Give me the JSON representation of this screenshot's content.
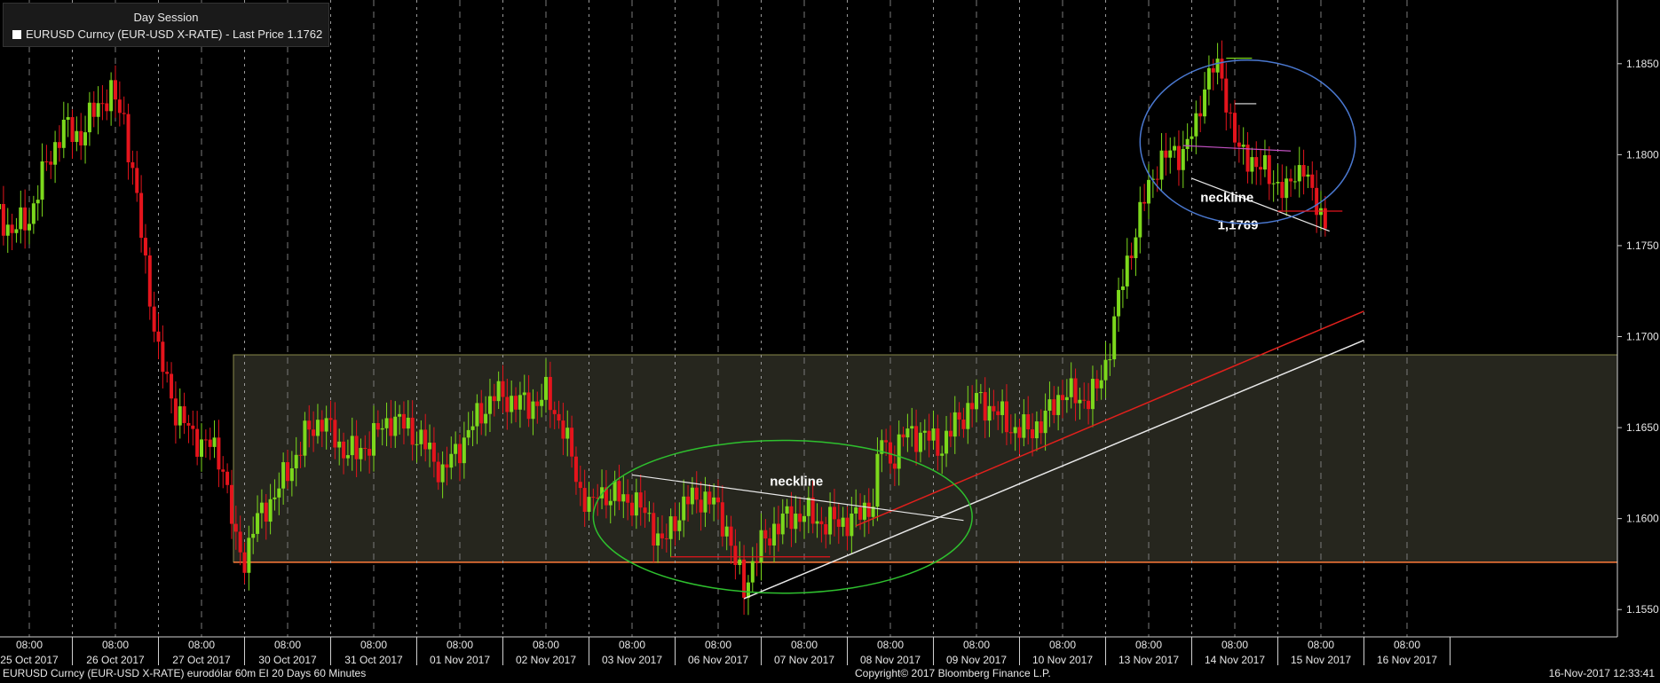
{
  "header": {
    "session": "Day Session",
    "series_label": "EURUSD Curncy (EUR-USD X-RATE) - Last Price 1.1762"
  },
  "footer": {
    "left": "EURUSD Curncy (EUR-USD X-RATE) eurodólar 60m EI 20 Days 60 Minutes",
    "center": "Copyright© 2017 Bloomberg Finance L.P.",
    "right": "16-Nov-2017 12:33:41"
  },
  "colors": {
    "up_candle": "#7cd81c",
    "down_candle": "#e4141c",
    "shaded_range": "#26261e",
    "support_line": "#ff7a3a",
    "trend_red": "#e0201c",
    "trend_white": "#e8e8e8",
    "ellipse_green": "#2ec02e",
    "ellipse_blue": "#4a78d0",
    "neckline_pink": "#c050c0"
  },
  "chart_data": {
    "type": "candlestick",
    "ylim": [
      1.1535,
      1.1885
    ],
    "y_ticks": [
      "1.1550",
      "1.1600",
      "1.1650",
      "1.1700",
      "1.1750",
      "1.1800",
      "1.1850"
    ],
    "days": [
      {
        "time": "08:00",
        "date": "25 Oct 2017"
      },
      {
        "time": "08:00",
        "date": "26 Oct 2017"
      },
      {
        "time": "08:00",
        "date": "27 Oct 2017"
      },
      {
        "time": "08:00",
        "date": "30 Oct 2017"
      },
      {
        "time": "08:00",
        "date": "31 Oct 2017"
      },
      {
        "time": "08:00",
        "date": "01 Nov 2017"
      },
      {
        "time": "08:00",
        "date": "02 Nov 2017"
      },
      {
        "time": "08:00",
        "date": "03 Nov 2017"
      },
      {
        "time": "08:00",
        "date": "06 Nov 2017"
      },
      {
        "time": "08:00",
        "date": "07 Nov 2017"
      },
      {
        "time": "08:00",
        "date": "08 Nov 2017"
      },
      {
        "time": "08:00",
        "date": "09 Nov 2017"
      },
      {
        "time": "08:00",
        "date": "10 Nov 2017"
      },
      {
        "time": "08:00",
        "date": "13 Nov 2017"
      },
      {
        "time": "08:00",
        "date": "14 Nov 2017"
      },
      {
        "time": "08:00",
        "date": "15 Nov 2017"
      },
      {
        "time": "08:00",
        "date": "16 Nov 2017"
      }
    ],
    "price_path": [
      [
        0,
        1.177
      ],
      [
        4,
        1.1758
      ],
      [
        8,
        1.1765
      ],
      [
        12,
        1.1795
      ],
      [
        16,
        1.1815
      ],
      [
        20,
        1.181
      ],
      [
        24,
        1.1828
      ],
      [
        27,
        1.1833
      ],
      [
        30,
        1.182
      ],
      [
        32,
        1.179
      ],
      [
        35,
        1.174
      ],
      [
        38,
        1.169
      ],
      [
        42,
        1.166
      ],
      [
        46,
        1.1645
      ],
      [
        50,
        1.164
      ],
      [
        53,
        1.163
      ],
      [
        56,
        1.1585
      ],
      [
        58,
        1.1578
      ],
      [
        60,
        1.1595
      ],
      [
        64,
        1.161
      ],
      [
        68,
        1.1625
      ],
      [
        72,
        1.1645
      ],
      [
        76,
        1.1655
      ],
      [
        80,
        1.164
      ],
      [
        84,
        1.1635
      ],
      [
        88,
        1.1645
      ],
      [
        92,
        1.1655
      ],
      [
        96,
        1.165
      ],
      [
        100,
        1.164
      ],
      [
        104,
        1.1625
      ],
      [
        108,
        1.164
      ],
      [
        112,
        1.1655
      ],
      [
        116,
        1.1668
      ],
      [
        120,
        1.1665
      ],
      [
        124,
        1.1662
      ],
      [
        128,
        1.1668
      ],
      [
        132,
        1.165
      ],
      [
        136,
        1.1615
      ],
      [
        139,
        1.1605
      ],
      [
        140,
        1.1615
      ],
      [
        144,
        1.1612
      ],
      [
        148,
        1.161
      ],
      [
        152,
        1.16
      ],
      [
        155,
        1.1585
      ],
      [
        158,
        1.16
      ],
      [
        161,
        1.161
      ],
      [
        164,
        1.1612
      ],
      [
        167,
        1.1608
      ],
      [
        170,
        1.1595
      ],
      [
        172,
        1.1575
      ],
      [
        174,
        1.1562
      ],
      [
        176,
        1.1575
      ],
      [
        178,
        1.1585
      ],
      [
        181,
        1.1595
      ],
      [
        184,
        1.16
      ],
      [
        188,
        1.1603
      ],
      [
        192,
        1.1598
      ],
      [
        196,
        1.1598
      ],
      [
        200,
        1.16
      ],
      [
        204,
        1.161
      ],
      [
        206,
        1.1645
      ],
      [
        208,
        1.1632
      ],
      [
        212,
        1.1648
      ],
      [
        216,
        1.1645
      ],
      [
        220,
        1.164
      ],
      [
        224,
        1.1655
      ],
      [
        228,
        1.1665
      ],
      [
        232,
        1.166
      ],
      [
        236,
        1.165
      ],
      [
        240,
        1.1648
      ],
      [
        244,
        1.1655
      ],
      [
        248,
        1.167
      ],
      [
        252,
        1.1665
      ],
      [
        256,
        1.167
      ],
      [
        258,
        1.1685
      ],
      [
        261,
        1.172
      ],
      [
        264,
        1.175
      ],
      [
        267,
        1.1775
      ],
      [
        270,
        1.1795
      ],
      [
        273,
        1.18
      ],
      [
        276,
        1.1802
      ],
      [
        279,
        1.1815
      ],
      [
        281,
        1.184
      ],
      [
        283,
        1.1848
      ],
      [
        285,
        1.1842
      ],
      [
        287,
        1.182
      ],
      [
        289,
        1.18
      ],
      [
        292,
        1.1798
      ],
      [
        295,
        1.179
      ],
      [
        298,
        1.1785
      ],
      [
        300,
        1.1778
      ],
      [
        302,
        1.179
      ],
      [
        304,
        1.1795
      ],
      [
        306,
        1.1775
      ],
      [
        309,
        1.1765
      ]
    ],
    "range_box": {
      "top": 1.169,
      "bottom": 1.1576
    },
    "support_line": {
      "value": 1.1576
    },
    "trend_lines": [
      {
        "color": "trend_red",
        "from": [
          200,
          1.1596
        ],
        "to": [
          318,
          1.1714
        ]
      },
      {
        "color": "trend_white",
        "from": [
          174,
          1.1556
        ],
        "to": [
          318,
          1.1698
        ]
      }
    ],
    "annotations": [
      {
        "type": "neckline",
        "label": "neckline",
        "from": [
          148,
          1.1624
        ],
        "to": [
          225,
          1.1599
        ],
        "label_at": [
          180,
          1.1618
        ],
        "label_size": 15
      },
      {
        "type": "neckline",
        "label": "neckline",
        "from": [
          278,
          1.1787
        ],
        "to": [
          310,
          1.1758
        ],
        "label_at": [
          280,
          1.1774
        ],
        "label_size": 15
      },
      {
        "type": "value",
        "label": "1,1769",
        "label_at": [
          284,
          1.1759
        ],
        "label_size": 15
      },
      {
        "type": "ellipse",
        "color": "ellipse_green",
        "center": [
          183,
          1.1601
        ],
        "rx": 44,
        "ry": 0.0042
      },
      {
        "type": "ellipse",
        "color": "ellipse_blue",
        "center": [
          291,
          1.1807
        ],
        "rx": 25,
        "ry": 0.0045
      },
      {
        "type": "hline",
        "color": "down_candle",
        "from": [
          157,
          1.1579
        ],
        "to": [
          194,
          1.1579
        ]
      },
      {
        "type": "hline",
        "color": "down_candle",
        "from": [
          298,
          1.1769
        ],
        "to": [
          313,
          1.1769
        ]
      },
      {
        "type": "segment",
        "color": "neckline_pink",
        "from": [
          276,
          1.1805
        ],
        "to": [
          301,
          1.1802
        ]
      },
      {
        "type": "hline",
        "color": "up_candle",
        "from": [
          286,
          1.1853
        ],
        "to": [
          292,
          1.1853
        ]
      },
      {
        "type": "hline",
        "color": "trend_white",
        "from": [
          288,
          1.1828
        ],
        "to": [
          293,
          1.1828
        ]
      }
    ]
  }
}
